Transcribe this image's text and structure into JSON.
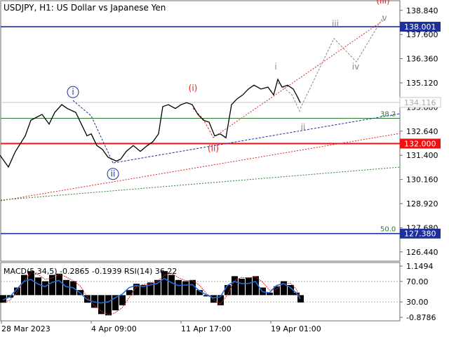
{
  "header": {
    "title": "USDJPY, H1:  US Dollar vs Japanese Yen"
  },
  "chart_data": {
    "type": "line",
    "instrument": "USDJPY",
    "timeframe": "H1",
    "title": "USDJPY, H1:  US Dollar vs Japanese Yen",
    "price_axis": {
      "ticks": [
        "138.840",
        "137.600",
        "136.360",
        "135.120",
        "133.880",
        "132.640",
        "131.400",
        "130.160",
        "128.920",
        "127.680",
        "126.440"
      ],
      "ylim": [
        126.0,
        139.3
      ]
    },
    "time_axis": {
      "ticks": [
        "28 Mar 2023",
        "4 Apr 09:00",
        "11 Apr 17:00",
        "19 Apr 01:00"
      ]
    },
    "current_price": "134.116",
    "levels": [
      {
        "name": "resistance",
        "value": "138.001",
        "color": "#1f2f9a"
      },
      {
        "name": "key-level",
        "value": "132.000",
        "color": "#ee1111"
      },
      {
        "name": "support",
        "value": "127.380",
        "color": "#1f2f9a"
      }
    ],
    "fib_levels": [
      {
        "label": "38.2",
        "value": 133.3
      },
      {
        "label": "50.0",
        "value": 127.38
      }
    ],
    "price_path": [
      [
        0,
        131.4
      ],
      [
        12,
        130.8
      ],
      [
        22,
        131.6
      ],
      [
        36,
        132.4
      ],
      [
        44,
        133.2
      ],
      [
        60,
        133.5
      ],
      [
        70,
        133.0
      ],
      [
        78,
        133.6
      ],
      [
        88,
        134.0
      ],
      [
        96,
        133.8
      ],
      [
        108,
        133.6
      ],
      [
        116,
        133.0
      ],
      [
        124,
        132.4
      ],
      [
        130,
        132.5
      ],
      [
        138,
        131.9
      ],
      [
        146,
        131.7
      ],
      [
        154,
        131.3
      ],
      [
        160,
        131.2
      ],
      [
        166,
        131.1
      ],
      [
        172,
        131.2
      ],
      [
        180,
        131.6
      ],
      [
        190,
        131.9
      ],
      [
        200,
        131.6
      ],
      [
        210,
        131.9
      ],
      [
        218,
        132.1
      ],
      [
        226,
        132.5
      ],
      [
        232,
        133.9
      ],
      [
        240,
        134.0
      ],
      [
        250,
        133.8
      ],
      [
        258,
        134.0
      ],
      [
        266,
        134.1
      ],
      [
        274,
        134.0
      ],
      [
        282,
        133.5
      ],
      [
        290,
        133.2
      ],
      [
        298,
        133.1
      ],
      [
        306,
        132.4
      ],
      [
        314,
        132.5
      ],
      [
        322,
        132.3
      ],
      [
        330,
        134.0
      ],
      [
        338,
        134.3
      ],
      [
        346,
        134.5
      ],
      [
        354,
        134.8
      ],
      [
        362,
        135.0
      ],
      [
        372,
        134.8
      ],
      [
        382,
        134.9
      ],
      [
        390,
        134.5
      ],
      [
        396,
        135.3
      ],
      [
        402,
        134.9
      ],
      [
        410,
        135.0
      ],
      [
        418,
        134.8
      ],
      [
        424,
        134.4
      ],
      [
        428,
        134.1
      ]
    ],
    "wave_labels": [
      {
        "text": "i",
        "circled": true,
        "color": "#1f2f9a",
        "t": 104,
        "p": 134.5
      },
      {
        "text": "ii",
        "circled": true,
        "color": "#1f2f9a",
        "t": 161,
        "p": 130.3
      },
      {
        "text": "(i)",
        "circled": false,
        "color": "#dd2222",
        "t": 275,
        "p": 134.7
      },
      {
        "text": "(ii)",
        "circled": false,
        "color": "#dd2222",
        "t": 304,
        "p": 131.6
      },
      {
        "text": "(iii)",
        "circled": false,
        "color": "#dd2222",
        "t": 546,
        "p": 139.2
      },
      {
        "text": "i",
        "circled": false,
        "color": "#888888",
        "t": 393,
        "p": 135.8
      },
      {
        "text": "ii",
        "circled": false,
        "color": "#888888",
        "t": 432,
        "p": 132.7
      },
      {
        "text": "iii",
        "circled": false,
        "color": "#888888",
        "t": 478,
        "p": 138.0
      },
      {
        "text": "iv",
        "circled": false,
        "color": "#888888",
        "t": 507,
        "p": 135.8
      },
      {
        "text": "v",
        "circled": false,
        "color": "#888888",
        "t": 548,
        "p": 138.3
      }
    ],
    "forecast_path": [
      [
        428,
        133.8
      ],
      [
        476,
        137.4
      ],
      [
        508,
        136.2
      ],
      [
        548,
        138.6
      ]
    ],
    "indicator": {
      "label": "MACD(5,34,5) -0.2865 -0.1939 RSI(14) 36.22",
      "ticks": [
        "1.1494",
        "70.00",
        "30.00",
        "-0.8786"
      ],
      "macd": [
        [
          4,
          -0.3
        ],
        [
          14,
          -0.1
        ],
        [
          24,
          0.3
        ],
        [
          34,
          0.8
        ],
        [
          44,
          0.95
        ],
        [
          54,
          0.7
        ],
        [
          64,
          0.55
        ],
        [
          74,
          0.8
        ],
        [
          84,
          0.85
        ],
        [
          94,
          0.6
        ],
        [
          104,
          0.55
        ],
        [
          114,
          0.2
        ],
        [
          124,
          -0.3
        ],
        [
          134,
          -0.5
        ],
        [
          144,
          -0.75
        ],
        [
          154,
          -0.8
        ],
        [
          164,
          -0.6
        ],
        [
          174,
          -0.4
        ],
        [
          184,
          0.2
        ],
        [
          194,
          0.45
        ],
        [
          204,
          0.4
        ],
        [
          214,
          0.5
        ],
        [
          224,
          0.6
        ],
        [
          234,
          0.95
        ],
        [
          244,
          0.8
        ],
        [
          254,
          0.6
        ],
        [
          264,
          0.55
        ],
        [
          274,
          0.6
        ],
        [
          284,
          0.2
        ],
        [
          294,
          -0.05
        ],
        [
          304,
          -0.3
        ],
        [
          314,
          -0.4
        ],
        [
          324,
          0.4
        ],
        [
          334,
          0.75
        ],
        [
          344,
          0.65
        ],
        [
          354,
          0.7
        ],
        [
          364,
          0.75
        ],
        [
          374,
          0.3
        ],
        [
          384,
          0.1
        ],
        [
          394,
          0.35
        ],
        [
          404,
          0.55
        ],
        [
          414,
          0.4
        ],
        [
          422,
          0.1
        ],
        [
          428,
          -0.29
        ]
      ],
      "rsi": [
        [
          4,
          34
        ],
        [
          14,
          40
        ],
        [
          24,
          55
        ],
        [
          34,
          70
        ],
        [
          44,
          74
        ],
        [
          54,
          65
        ],
        [
          64,
          60
        ],
        [
          74,
          68
        ],
        [
          84,
          72
        ],
        [
          94,
          60
        ],
        [
          104,
          58
        ],
        [
          114,
          48
        ],
        [
          124,
          35
        ],
        [
          134,
          30
        ],
        [
          144,
          28
        ],
        [
          154,
          30
        ],
        [
          164,
          38
        ],
        [
          174,
          45
        ],
        [
          184,
          58
        ],
        [
          194,
          62
        ],
        [
          204,
          60
        ],
        [
          214,
          63
        ],
        [
          224,
          66
        ],
        [
          234,
          76
        ],
        [
          244,
          68
        ],
        [
          254,
          62
        ],
        [
          264,
          63
        ],
        [
          274,
          64
        ],
        [
          284,
          52
        ],
        [
          294,
          44
        ],
        [
          304,
          38
        ],
        [
          314,
          40
        ],
        [
          324,
          62
        ],
        [
          334,
          70
        ],
        [
          344,
          66
        ],
        [
          354,
          66
        ],
        [
          364,
          70
        ],
        [
          374,
          50
        ],
        [
          384,
          48
        ],
        [
          394,
          62
        ],
        [
          404,
          66
        ],
        [
          414,
          58
        ],
        [
          422,
          48
        ],
        [
          428,
          36
        ]
      ]
    }
  }
}
